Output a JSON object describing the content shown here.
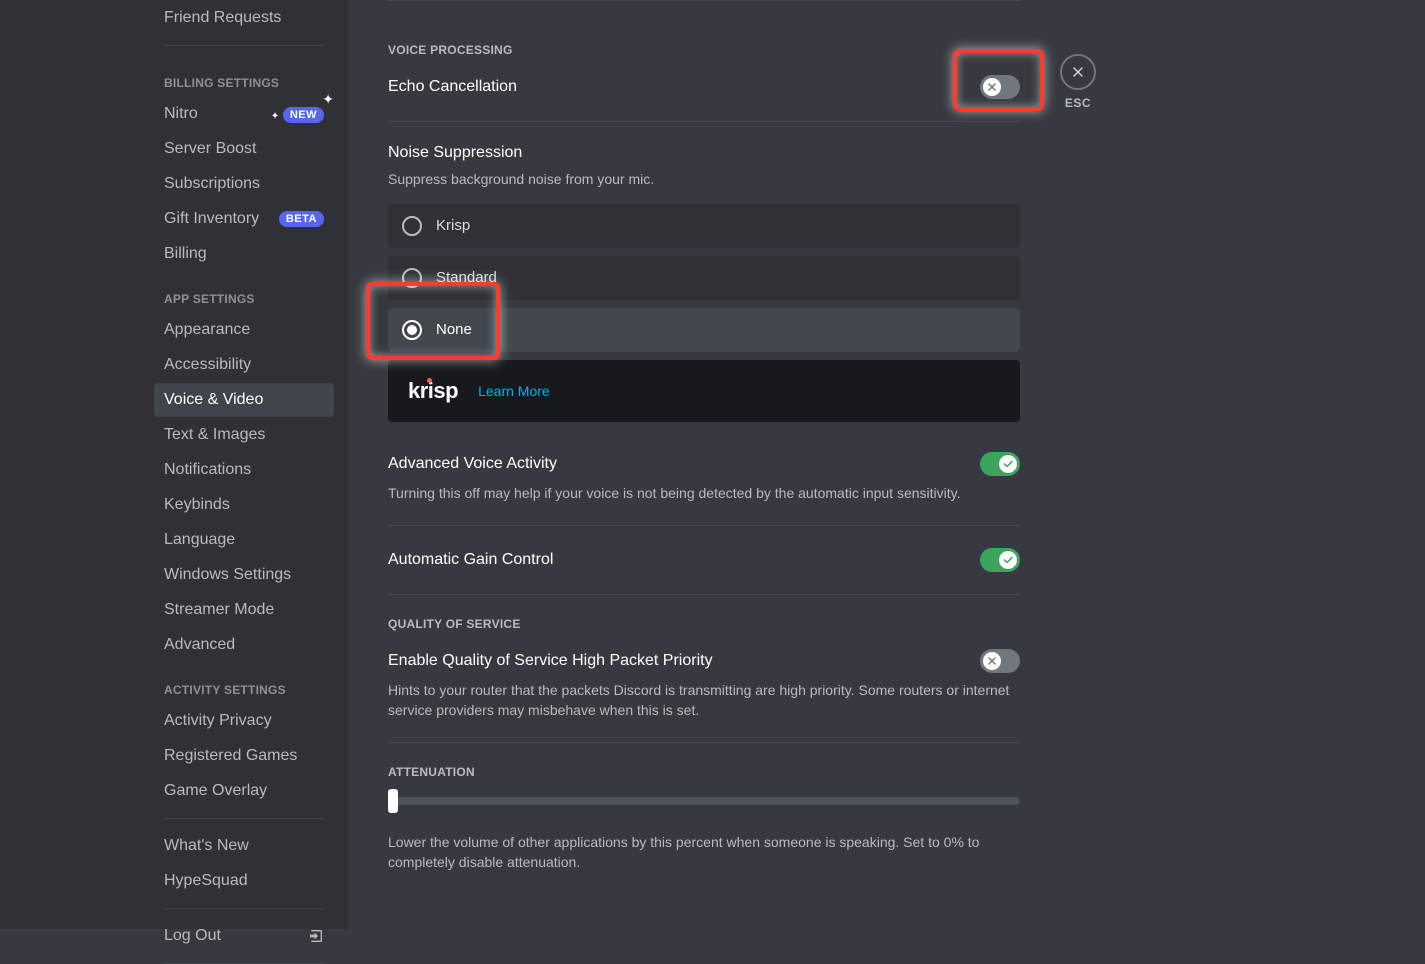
{
  "sidebar": {
    "top_item": "Friend Requests",
    "billing_heading": "BILLING SETTINGS",
    "billing_items": [
      {
        "label": "Nitro",
        "badge": "NEW"
      },
      {
        "label": "Server Boost"
      },
      {
        "label": "Subscriptions"
      },
      {
        "label": "Gift Inventory",
        "badge": "BETA"
      },
      {
        "label": "Billing"
      }
    ],
    "app_heading": "APP SETTINGS",
    "app_items": [
      {
        "label": "Appearance"
      },
      {
        "label": "Accessibility"
      },
      {
        "label": "Voice & Video",
        "active": true
      },
      {
        "label": "Text & Images"
      },
      {
        "label": "Notifications"
      },
      {
        "label": "Keybinds"
      },
      {
        "label": "Language"
      },
      {
        "label": "Windows Settings"
      },
      {
        "label": "Streamer Mode"
      },
      {
        "label": "Advanced"
      }
    ],
    "activity_heading": "ACTIVITY SETTINGS",
    "activity_items": [
      {
        "label": "Activity Privacy"
      },
      {
        "label": "Registered Games"
      },
      {
        "label": "Game Overlay"
      }
    ],
    "bottom_items": [
      {
        "label": "What's New"
      },
      {
        "label": "HypeSquad"
      }
    ],
    "logout": "Log Out"
  },
  "close": {
    "esc": "ESC"
  },
  "voice_processing": {
    "heading": "VOICE PROCESSING",
    "echo_label": "Echo Cancellation",
    "echo_on": false,
    "noise_label": "Noise Suppression",
    "noise_desc": "Suppress background noise from your mic.",
    "options": [
      {
        "label": "Krisp",
        "selected": false
      },
      {
        "label": "Standard",
        "selected": false
      },
      {
        "label": "None",
        "selected": true
      }
    ],
    "krisp_logo": "krisp",
    "learn_more": "Learn More",
    "ava_label": "Advanced Voice Activity",
    "ava_desc": "Turning this off may help if your voice is not being detected by the automatic input sensitivity.",
    "ava_on": true,
    "agc_label": "Automatic Gain Control",
    "agc_on": true
  },
  "qos": {
    "heading": "QUALITY OF SERVICE",
    "label": "Enable Quality of Service High Packet Priority",
    "desc": "Hints to your router that the packets Discord is transmitting are high priority. Some routers or internet service providers may misbehave when this is set.",
    "on": false
  },
  "attenuation": {
    "heading": "ATTENUATION",
    "value_pct": 0,
    "desc": "Lower the volume of other applications by this percent when someone is speaking. Set to 0% to completely disable attenuation."
  }
}
